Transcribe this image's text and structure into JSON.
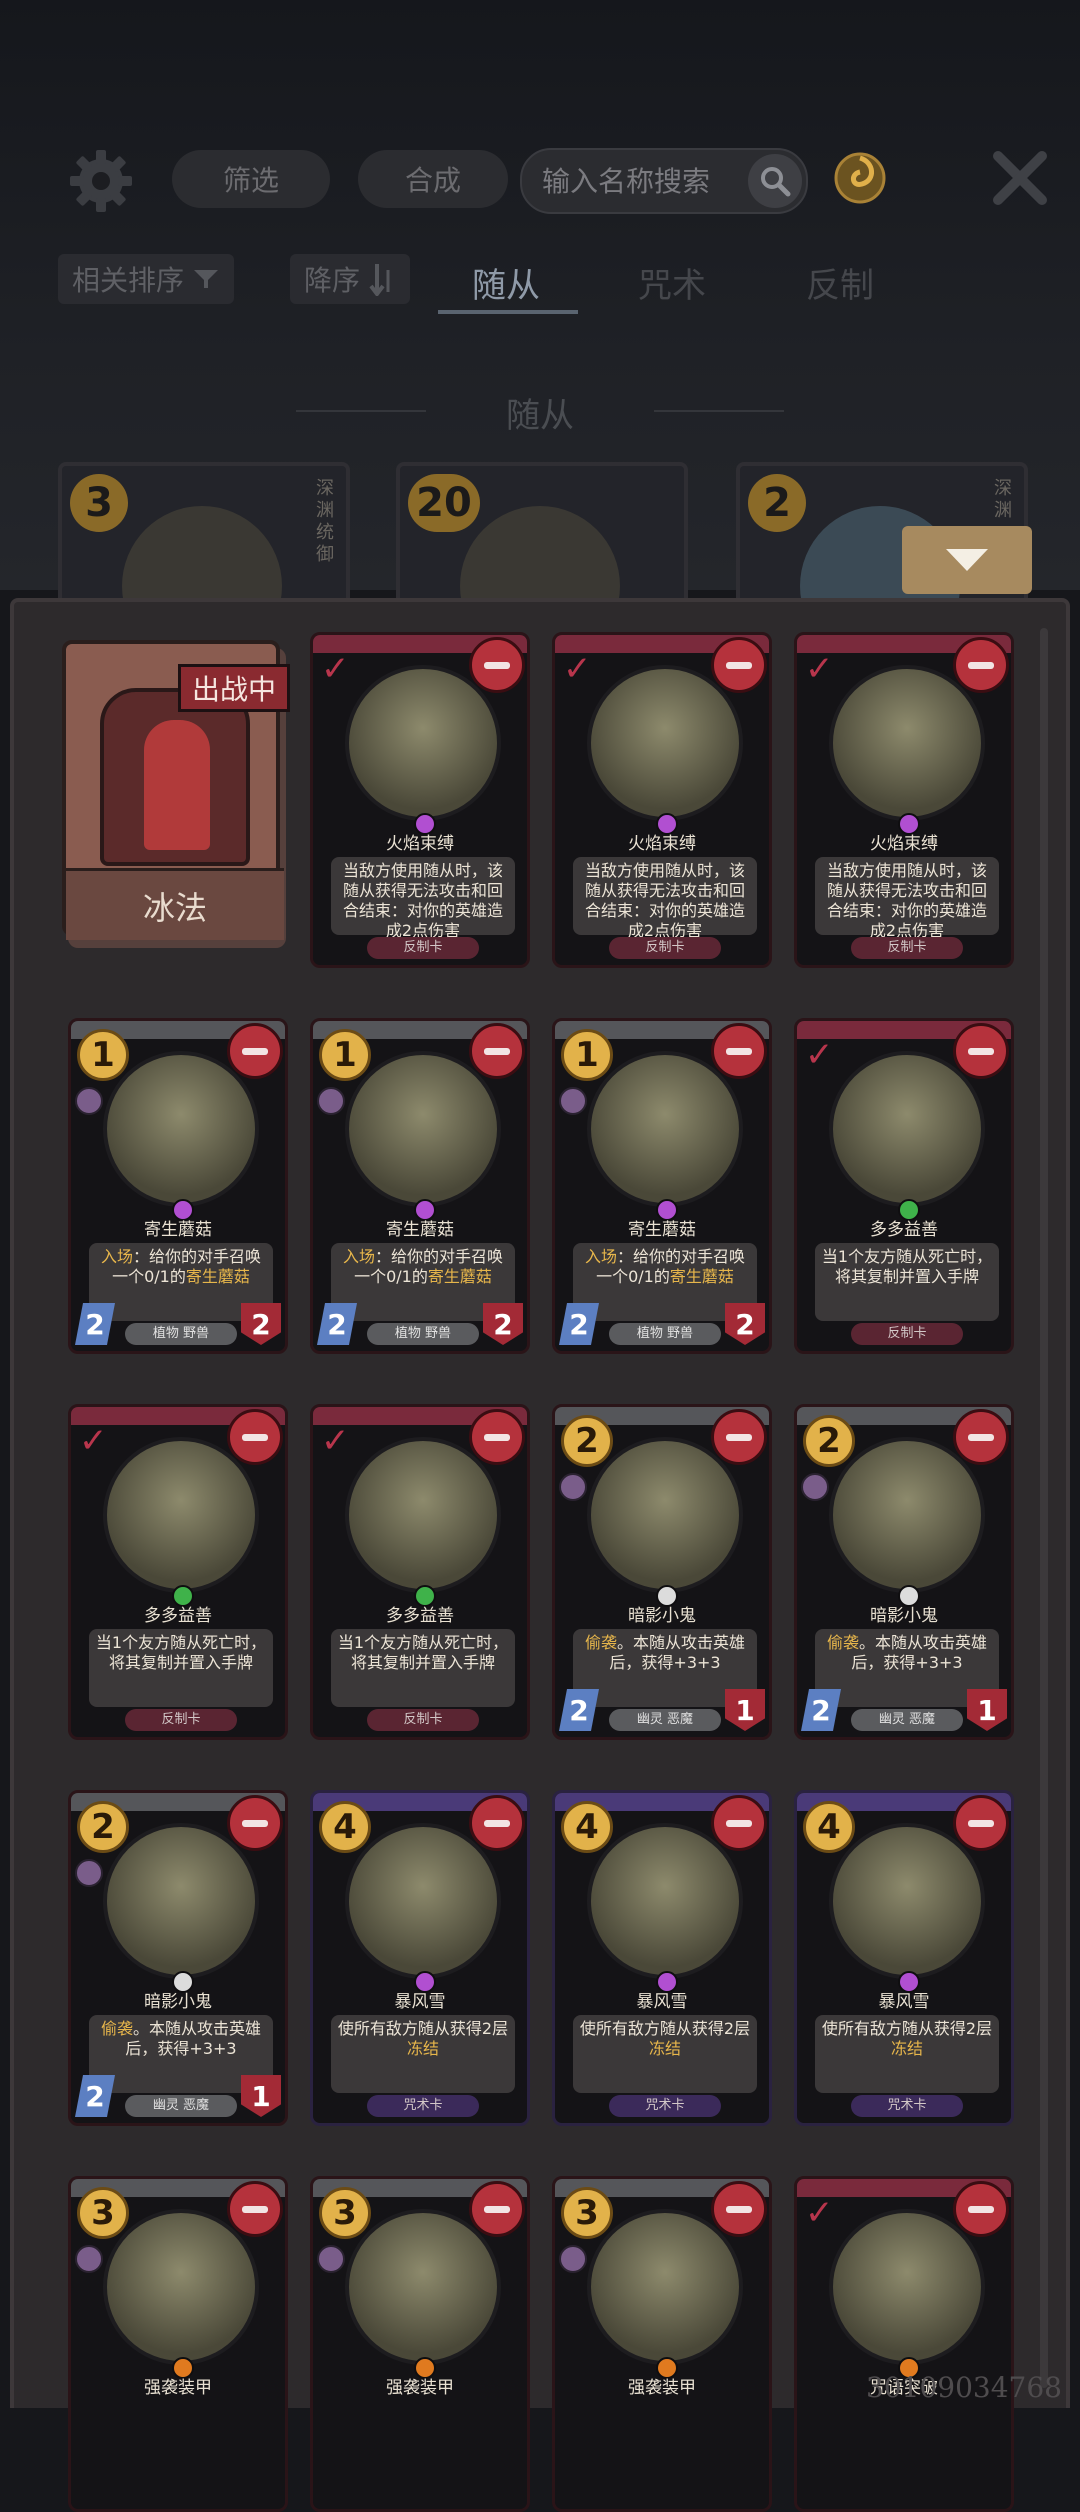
{
  "toolbar": {
    "filter_label": "筛选",
    "craft_label": "合成",
    "search_placeholder": "输入名称搜索"
  },
  "sort": {
    "relevance_label": "相关排序",
    "order_label": "降序"
  },
  "tabs": [
    {
      "label": "随从",
      "active": true
    },
    {
      "label": "咒术",
      "active": false
    },
    {
      "label": "反制",
      "active": false
    }
  ],
  "section_title": "随从",
  "background_cards": [
    {
      "cost": "3",
      "side_text": "深渊统御"
    },
    {
      "cost": "20",
      "side_text": ""
    },
    {
      "cost": "2",
      "side_text": "深渊"
    }
  ],
  "hero": {
    "badge": "出战中",
    "name": "冰法"
  },
  "deck_cards": [
    {
      "name": "火焰束缚",
      "cost": "",
      "desc": "当敌方使用随从时，该随从获得无法攻击和回合结束：对你的英雄造成2点伤害",
      "type": "反制卡",
      "type_kind": "counter",
      "gem": "#b14fd1",
      "atk": "",
      "hp": ""
    },
    {
      "name": "火焰束缚",
      "cost": "",
      "desc": "当敌方使用随从时，该随从获得无法攻击和回合结束：对你的英雄造成2点伤害",
      "type": "反制卡",
      "type_kind": "counter",
      "gem": "#b14fd1",
      "atk": "",
      "hp": ""
    },
    {
      "name": "火焰束缚",
      "cost": "",
      "desc": "当敌方使用随从时，该随从获得无法攻击和回合结束：对你的英雄造成2点伤害",
      "type": "反制卡",
      "type_kind": "counter",
      "gem": "#b14fd1",
      "atk": "",
      "hp": ""
    },
    {
      "name": "寄生蘑菇",
      "cost": "1",
      "desc_kw": "入场",
      "desc": "：给你的对手召唤一个0/1的",
      "desc_kw2": "寄生蘑菇",
      "type": "植物 野兽",
      "type_kind": "minion",
      "gem": "#b14fd1",
      "atk": "2",
      "hp": "2"
    },
    {
      "name": "寄生蘑菇",
      "cost": "1",
      "desc_kw": "入场",
      "desc": "：给你的对手召唤一个0/1的",
      "desc_kw2": "寄生蘑菇",
      "type": "植物 野兽",
      "type_kind": "minion",
      "gem": "#b14fd1",
      "atk": "2",
      "hp": "2"
    },
    {
      "name": "寄生蘑菇",
      "cost": "1",
      "desc_kw": "入场",
      "desc": "：给你的对手召唤一个0/1的",
      "desc_kw2": "寄生蘑菇",
      "type": "植物 野兽",
      "type_kind": "minion",
      "gem": "#b14fd1",
      "atk": "2",
      "hp": "2"
    },
    {
      "name": "多多益善",
      "cost": "",
      "desc": "当1个友方随从死亡时，将其复制并置入手牌",
      "type": "反制卡",
      "type_kind": "counter",
      "gem": "#3fb24a",
      "atk": "",
      "hp": ""
    },
    {
      "name": "多多益善",
      "cost": "",
      "desc": "当1个友方随从死亡时，将其复制并置入手牌",
      "type": "反制卡",
      "type_kind": "counter",
      "gem": "#3fb24a",
      "atk": "",
      "hp": ""
    },
    {
      "name": "多多益善",
      "cost": "",
      "desc": "当1个友方随从死亡时，将其复制并置入手牌",
      "type": "反制卡",
      "type_kind": "counter",
      "gem": "#3fb24a",
      "atk": "",
      "hp": ""
    },
    {
      "name": "暗影小鬼",
      "cost": "2",
      "desc_kw": "偷袭",
      "desc": "。本随从攻击英雄后，获得+3+3",
      "type": "幽灵 恶魔",
      "type_kind": "minion",
      "gem": "#dcdcdc",
      "atk": "2",
      "hp": "1"
    },
    {
      "name": "暗影小鬼",
      "cost": "2",
      "desc_kw": "偷袭",
      "desc": "。本随从攻击英雄后，获得+3+3",
      "type": "幽灵 恶魔",
      "type_kind": "minion",
      "gem": "#dcdcdc",
      "atk": "2",
      "hp": "1"
    },
    {
      "name": "暗影小鬼",
      "cost": "2",
      "desc_kw": "偷袭",
      "desc": "。本随从攻击英雄后，获得+3+3",
      "type": "幽灵 恶魔",
      "type_kind": "minion",
      "gem": "#dcdcdc",
      "atk": "2",
      "hp": "1"
    },
    {
      "name": "暴风雪",
      "cost": "4",
      "desc": "使所有敌方随从获得2层",
      "desc_kw2": "冻结",
      "type": "咒术卡",
      "type_kind": "spell",
      "gem": "#b14fd1",
      "atk": "",
      "hp": ""
    },
    {
      "name": "暴风雪",
      "cost": "4",
      "desc": "使所有敌方随从获得2层",
      "desc_kw2": "冻结",
      "type": "咒术卡",
      "type_kind": "spell",
      "gem": "#b14fd1",
      "atk": "",
      "hp": ""
    },
    {
      "name": "暴风雪",
      "cost": "4",
      "desc": "使所有敌方随从获得2层",
      "desc_kw2": "冻结",
      "type": "咒术卡",
      "type_kind": "spell",
      "gem": "#b14fd1",
      "atk": "",
      "hp": ""
    },
    {
      "name": "强袭装甲",
      "cost": "3",
      "desc": "",
      "type": "",
      "type_kind": "minion",
      "gem": "#e07a1f",
      "atk": "",
      "hp": ""
    },
    {
      "name": "强袭装甲",
      "cost": "3",
      "desc": "",
      "type": "",
      "type_kind": "minion",
      "gem": "#e07a1f",
      "atk": "",
      "hp": ""
    },
    {
      "name": "强袭装甲",
      "cost": "3",
      "desc": "",
      "type": "",
      "type_kind": "minion",
      "gem": "#e07a1f",
      "atk": "",
      "hp": ""
    },
    {
      "name": "咒语突破",
      "cost": "",
      "desc": "",
      "type": "",
      "type_kind": "counter",
      "gem": "#e07a1f",
      "atk": "",
      "hp": ""
    }
  ],
  "watermark": "30109034768"
}
